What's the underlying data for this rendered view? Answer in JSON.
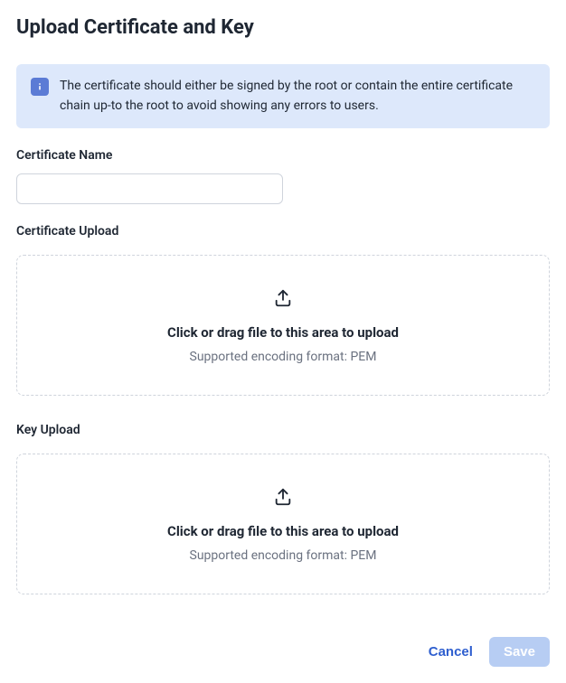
{
  "title": "Upload Certificate and Key",
  "info": {
    "text": "The certificate should either be signed by the root or contain the entire certificate chain up-to the root to avoid showing any errors to users."
  },
  "fields": {
    "cert_name_label": "Certificate Name",
    "cert_name_value": "",
    "cert_upload_label": "Certificate Upload",
    "key_upload_label": "Key Upload"
  },
  "upload": {
    "title": "Click or drag file to this area to upload",
    "subtitle": "Supported encoding format: PEM"
  },
  "footer": {
    "cancel": "Cancel",
    "save": "Save"
  }
}
